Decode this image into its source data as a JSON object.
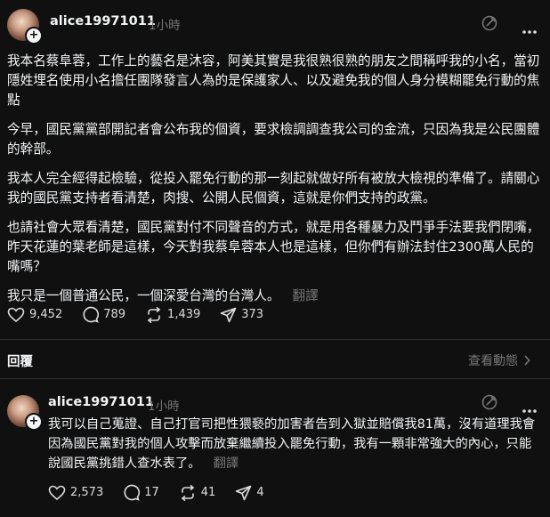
{
  "post": {
    "username": "alice19971011",
    "time": "1小時",
    "paragraphs": [
      "我本名蔡阜蓉，工作上的藝名是沐容，阿美其實是我很熟很熟的朋友之間稱呼我的小名，當初隱姓埋名使用小名擔任團隊發言人為的是保護家人、以及避免我的個人身分模糊罷免行動的焦點",
      "今早，國民黨黨部開記者會公布我的個資，要求檢調調查我公司的金流，只因為我是公民團體的幹部。",
      "我本人完全經得起檢驗，從投入罷免行動的那一刻起就做好所有被放大檢視的準備了。請關心我的國民黨支持者看清楚，肉搜、公開人民個資，這就是你們支持的政黨。",
      "也請社會大眾看清楚，國民黨對付不同聲音的方式，就是用各種暴力及鬥爭手法要我們閉嘴，昨天花蓮的葉老師是這樣，今天對我蔡阜蓉本人也是這樣，但你們有辦法封住2300萬人民的嘴嗎？",
      "我只是一個普通公民，一個深愛台灣的台灣人。"
    ],
    "translate": "翻譯",
    "likes": "9,452",
    "comments": "789",
    "reposts": "1,439",
    "shares": "373"
  },
  "replies_bar": {
    "label": "回覆",
    "activity": "查看動態"
  },
  "reply": {
    "username": "alice19971011",
    "time": "1小時",
    "text": "我可以自己蒐證、自己打官司把性猥褻的加害者告到入獄並賠償我81萬，沒有道理我會因為國民黨對我的個人攻擊而放棄繼續投入罷免行動，我有一顆非常強大的內心，只能說國民黨挑錯人查水表了。",
    "translate": "翻譯",
    "likes": "2,573",
    "comments": "17",
    "reposts": "41",
    "shares": "4"
  },
  "colors": {
    "background": "#101010",
    "text": "#f3f5f7",
    "muted": "#777777"
  },
  "icons": [
    "heart-icon",
    "comment-icon",
    "repost-icon",
    "share-icon",
    "pencil-circle-icon",
    "more-icon",
    "chevron-right-icon",
    "plus-icon"
  ]
}
